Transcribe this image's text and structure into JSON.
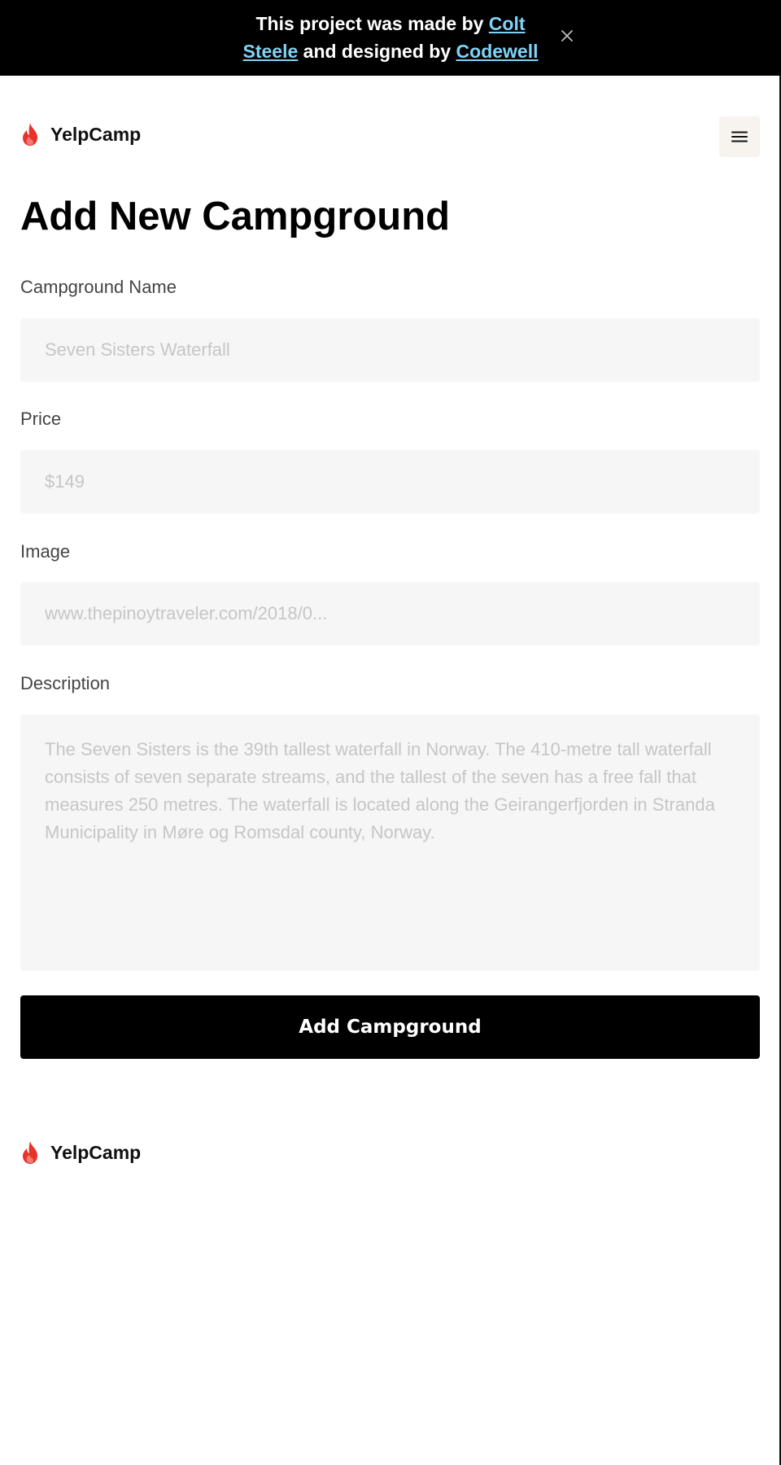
{
  "banner": {
    "prefix": "This project was made by",
    "author_first": "Colt",
    "author_last": "Steele",
    "middle": "and designed by",
    "designer": "Codewell",
    "close_icon": "close-icon"
  },
  "header": {
    "brand": "YelpCamp",
    "logo_icon": "flame-icon",
    "menu_icon": "hamburger-menu-icon"
  },
  "form": {
    "title": "Add New Campground",
    "name_label": "Campground Name",
    "name_placeholder": "Seven Sisters Waterfall",
    "price_label": "Price",
    "price_placeholder": "$149",
    "image_label": "Image",
    "image_placeholder": "www.thepinoytraveler.com/2018/0...",
    "description_label": "Description",
    "description_placeholder": "The Seven Sisters is the 39th tallest waterfall in Norway. The 410-metre tall waterfall consists of seven separate streams, and the tallest of the seven has a free fall that measures 250 metres. The waterfall is located along the Geirangerfjorden in Stranda Municipality in Møre og Romsdal county, Norway.",
    "submit_label": "Add Campground"
  },
  "footer": {
    "brand": "YelpCamp"
  },
  "colors": {
    "banner_bg": "#000000",
    "link": "#7fd3f7",
    "flame": "#e8332a",
    "input_bg": "#f6f6f6",
    "menu_bg": "#f7f3ee",
    "button_bg": "#000000"
  }
}
